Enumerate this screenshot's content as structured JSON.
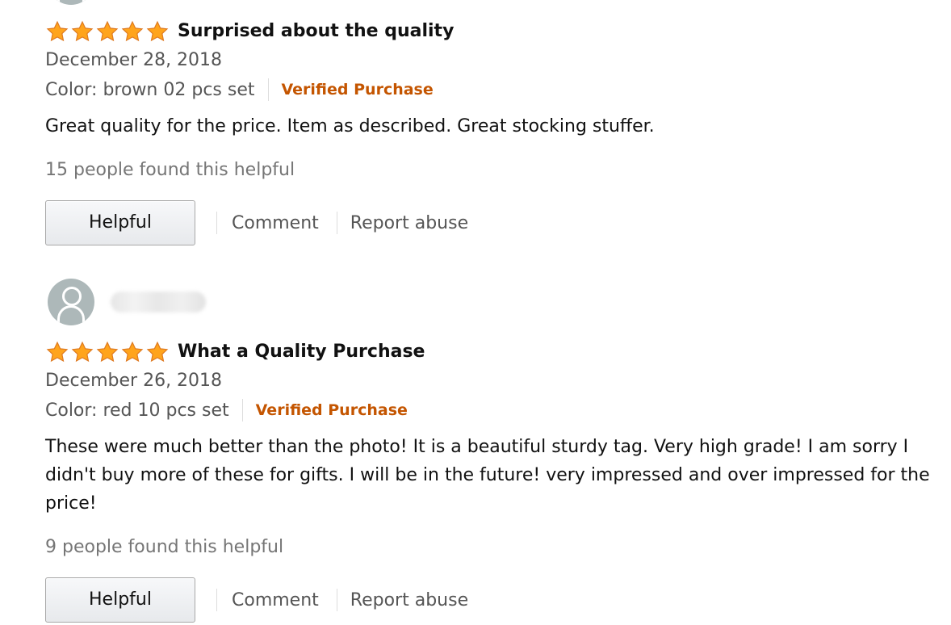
{
  "reviews": [
    {
      "stars": 5,
      "title": "Surprised about the quality",
      "date": "December 28, 2018",
      "variant": "Color: brown 02 pcs set",
      "badge": "Verified Purchase",
      "body": "Great quality for the price. Item as described. Great stocking stuffer.",
      "helpful_count": "15 people found this helpful",
      "helpful_label": "Helpful",
      "comment_label": "Comment",
      "report_label": "Report abuse"
    },
    {
      "stars": 5,
      "title": "What a Quality Purchase",
      "date": "December 26, 2018",
      "variant": "Color: red 10 pcs set",
      "badge": "Verified Purchase",
      "body": "These were much better than the photo! It is a beautiful sturdy tag. Very high grade! I am sorry I didn't buy more of these for gifts. I will be in the future! very impressed and over impressed for the price!",
      "helpful_count": "9 people found this helpful",
      "helpful_label": "Helpful",
      "comment_label": "Comment",
      "report_label": "Report abuse"
    }
  ],
  "colors": {
    "star": "#ffa41c",
    "verified": "#c45500",
    "avatar": "#adb8b9"
  },
  "icons": {
    "star": "star-icon",
    "avatar": "user-avatar-icon"
  }
}
